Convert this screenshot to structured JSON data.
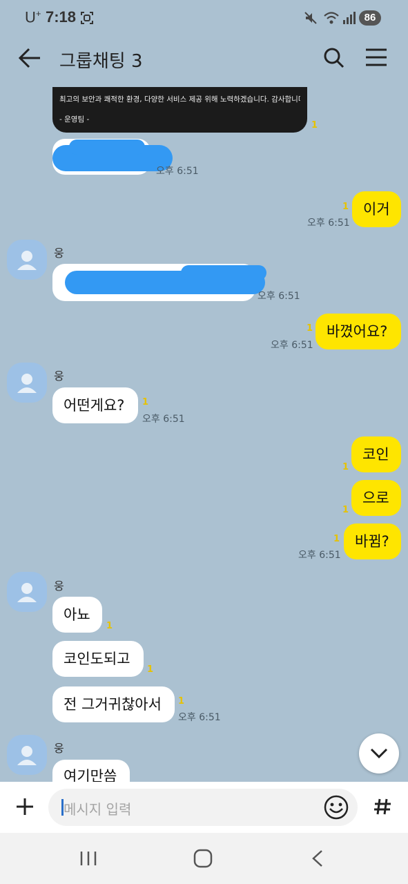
{
  "status_bar": {
    "carrier": "U",
    "carrier_sup": "+",
    "time": "7:18",
    "battery": "86"
  },
  "header": {
    "title": "그룹채팅 3",
    "icons": [
      "back-arrow-icon",
      "search-icon",
      "menu-icon"
    ]
  },
  "notice": {
    "line1": "최고의 보안과 쾌적한 환경, 다양한 서비스 제공 위해 노력하겠습니다. 감사합니다",
    "line2": "- 운영팀 -",
    "unread": "1"
  },
  "messages": {
    "m1": {
      "type": "received",
      "text": "",
      "time": "오후 6:51"
    },
    "m2": {
      "type": "sent",
      "text": "이거",
      "time": "오후 6:51",
      "unread": "1"
    },
    "sender1": "웅",
    "m3": {
      "type": "received",
      "text": "",
      "time": "오후 6:51"
    },
    "m4": {
      "type": "sent",
      "text": "바꼈어요?",
      "time": "오후 6:51",
      "unread": "1"
    },
    "sender2": "웅",
    "m5": {
      "type": "received",
      "text": "어떤게요?",
      "time": "오후 6:51",
      "unread": "1"
    },
    "m6": {
      "type": "sent",
      "text": "코인",
      "unread": "1"
    },
    "m7": {
      "type": "sent",
      "text": "으로",
      "unread": "1"
    },
    "m8": {
      "type": "sent",
      "text": "바뀜?",
      "time": "오후 6:51",
      "unread": "1"
    },
    "sender3": "웅",
    "m9": {
      "type": "received",
      "text": "아뇨",
      "unread": "1"
    },
    "m10": {
      "type": "received",
      "text": "코인도되고",
      "unread": "1"
    },
    "m11": {
      "type": "received",
      "text": "전 그거귀찮아서",
      "time": "오후 6:51",
      "unread": "1"
    },
    "sender4": "웅",
    "m12": {
      "type": "received",
      "text": "여기만씀"
    }
  },
  "input": {
    "placeholder": "메시지 입력"
  },
  "nav": {
    "icons": [
      "recent-apps-icon",
      "home-icon",
      "back-icon"
    ]
  },
  "colors": {
    "background": "#abc1d1",
    "sent_bubble": "#fee500",
    "received_bubble": "#ffffff",
    "unread_count": "#e6c200"
  }
}
